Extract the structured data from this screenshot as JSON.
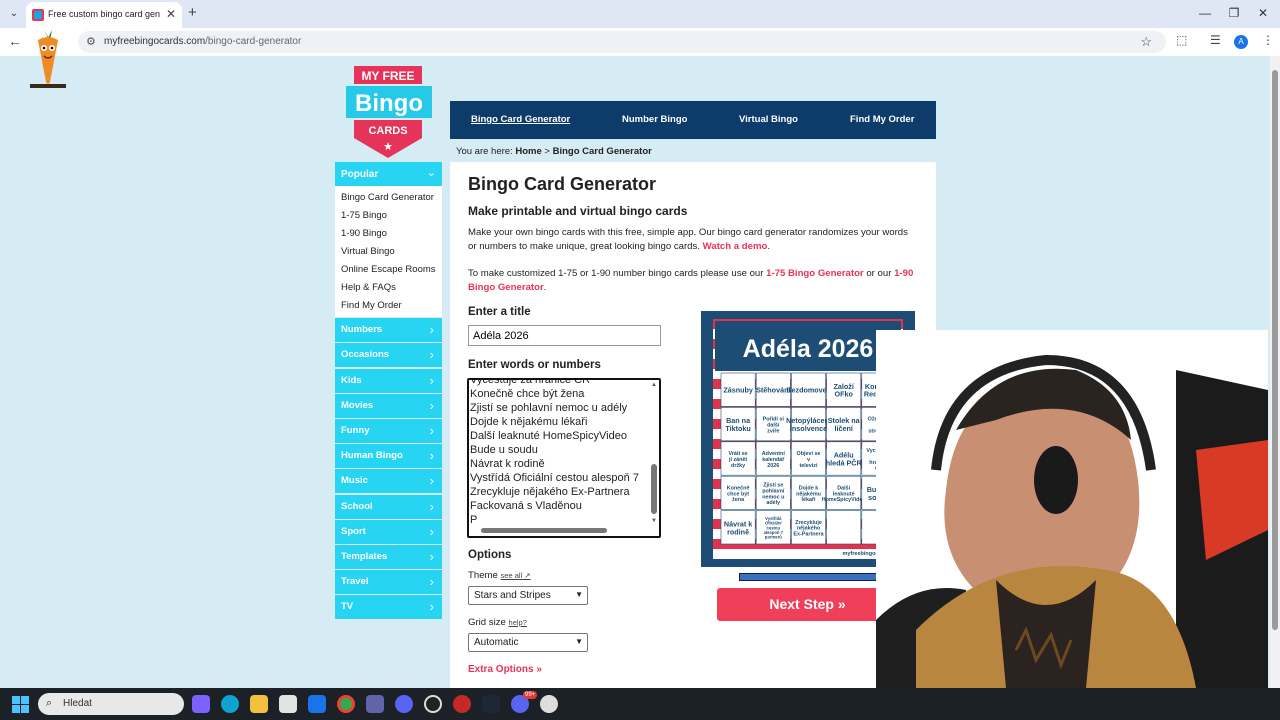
{
  "browser": {
    "tab_title": "Free custom bingo card generator",
    "new_tab": "+",
    "url_host": "myfreebingocards.com",
    "url_path": "/bingo-card-generator",
    "close": "✕",
    "minimize": "—",
    "restore": "❐"
  },
  "logo": {
    "top": "MY FREE",
    "middle": "Bingo",
    "bottom": "CARDS"
  },
  "topnav": [
    "Bingo Card Generator",
    "Number Bingo",
    "Virtual Bingo",
    "Find My Order"
  ],
  "breadcrumb": {
    "prefix": "You are here:",
    "home": "Home",
    "sep": ">",
    "current": "Bingo Card Generator"
  },
  "sidebar": {
    "popular": "Popular",
    "links": [
      "Bingo Card Generator",
      "1-75 Bingo",
      "1-90 Bingo",
      "Virtual Bingo",
      "Online Escape Rooms",
      "Help & FAQs",
      "Find My Order"
    ],
    "categories": [
      "Numbers",
      "Occasions",
      "Kids",
      "Movies",
      "Funny",
      "Human Bingo",
      "Music",
      "School",
      "Sport",
      "Templates",
      "Travel",
      "TV"
    ]
  },
  "main": {
    "title": "Bingo Card Generator",
    "subtitle": "Make printable and virtual bingo cards",
    "intro": "Make your own bingo cards with this free, simple app. Our bingo card generator randomizes your words or numbers to make unique, great looking bingo cards.",
    "demo_link": "Watch a demo",
    "custom_pre": "To make customized 1-75 or 1-90 number bingo cards please use our",
    "link_175": "1-75 Bingo Generator",
    "custom_mid": "or our",
    "link_190": "1-90 Bingo Generator",
    "enter_title_label": "Enter a title",
    "title_value": "Adéla 2026",
    "enter_words_label": "Enter words or numbers",
    "words": [
      "Vycestuje za hranice ČR",
      "Konečně chce být žena",
      "Zjistí se pohlavní nemoc u adély",
      "Dojde k nějakému lékaři",
      "Další leaknuté HomeSpicyVideo",
      "Bude u soudu",
      "Návrat k rodině",
      "Vystřídá Oficiální cestou alespoň 7",
      "Zrecykluje nějakého Ex-Partnera",
      "Fackovaná s Vladěnou",
      "P"
    ],
    "options_label": "Options",
    "theme_label": "Theme",
    "theme_see_all": "see all ↗",
    "theme_value": "Stars and Stripes",
    "grid_label": "Grid size",
    "grid_help": "help?",
    "grid_value": "Automatic",
    "extra_options": "Extra Options »",
    "next_step": "Next Step »"
  },
  "card_preview": {
    "title": "Adéla 2026",
    "cells": [
      "Zásnuby",
      "Stěhování",
      "Bezdomovec",
      "Založí OFko",
      "Konec v RedFace",
      "Ban na Tiktoku",
      "Pořídí si další zvíře",
      "Netopýlácení Insolvence",
      "Stolek na líčení",
      "Ožere se na streamu",
      "Vrátí se jí zánět držky",
      "Adventní kalendář 2026",
      "Objeví se v televizi",
      "Adélu hledá PČR",
      "Vycestuje za hranice ČR",
      "Konečně chce být žena",
      "Zjistí se pohlavní nemoc u adély",
      "Dojde k nějakému lékaři",
      "Další leaknuté HomeSpicyVideo",
      "Bude u soudu",
      "Návrat k rodině",
      "Vystřídá Oficiální cestou alespoň 7 partnerů",
      "Zrecykluje nějakého Ex-Partnera",
      "",
      ""
    ],
    "footer": "myfreebingocards.com"
  },
  "taskbar": {
    "search_placeholder": "Hledat",
    "badge": "99+"
  }
}
